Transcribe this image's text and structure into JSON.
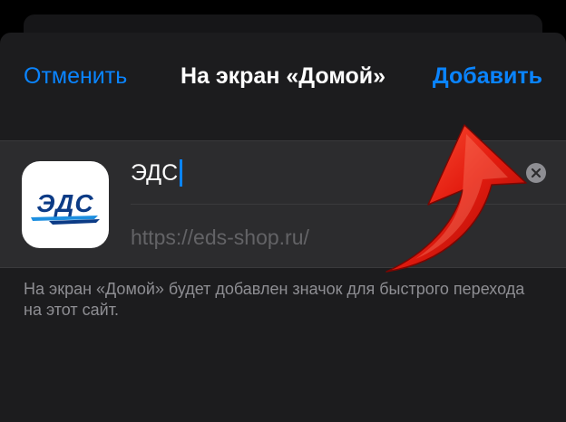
{
  "nav": {
    "cancel_label": "Отменить",
    "title": "На экран «Домой»",
    "add_label": "Добавить"
  },
  "form": {
    "name_value": "ЭДС",
    "url_value": "https://eds-shop.ru/",
    "app_icon_text": "ЭДС"
  },
  "footer": {
    "note": "На экран «Домой» будет добавлен значок для быстрого перехода на этот сайт."
  },
  "colors": {
    "accent": "#0a84ff",
    "background": "#1c1c1e",
    "brand_blue": "#0c3b86",
    "arrow_red": "#e31b0f"
  },
  "icons": {
    "clear": "clear-x-circle-icon",
    "annotation": "red-curved-arrow-icon"
  }
}
